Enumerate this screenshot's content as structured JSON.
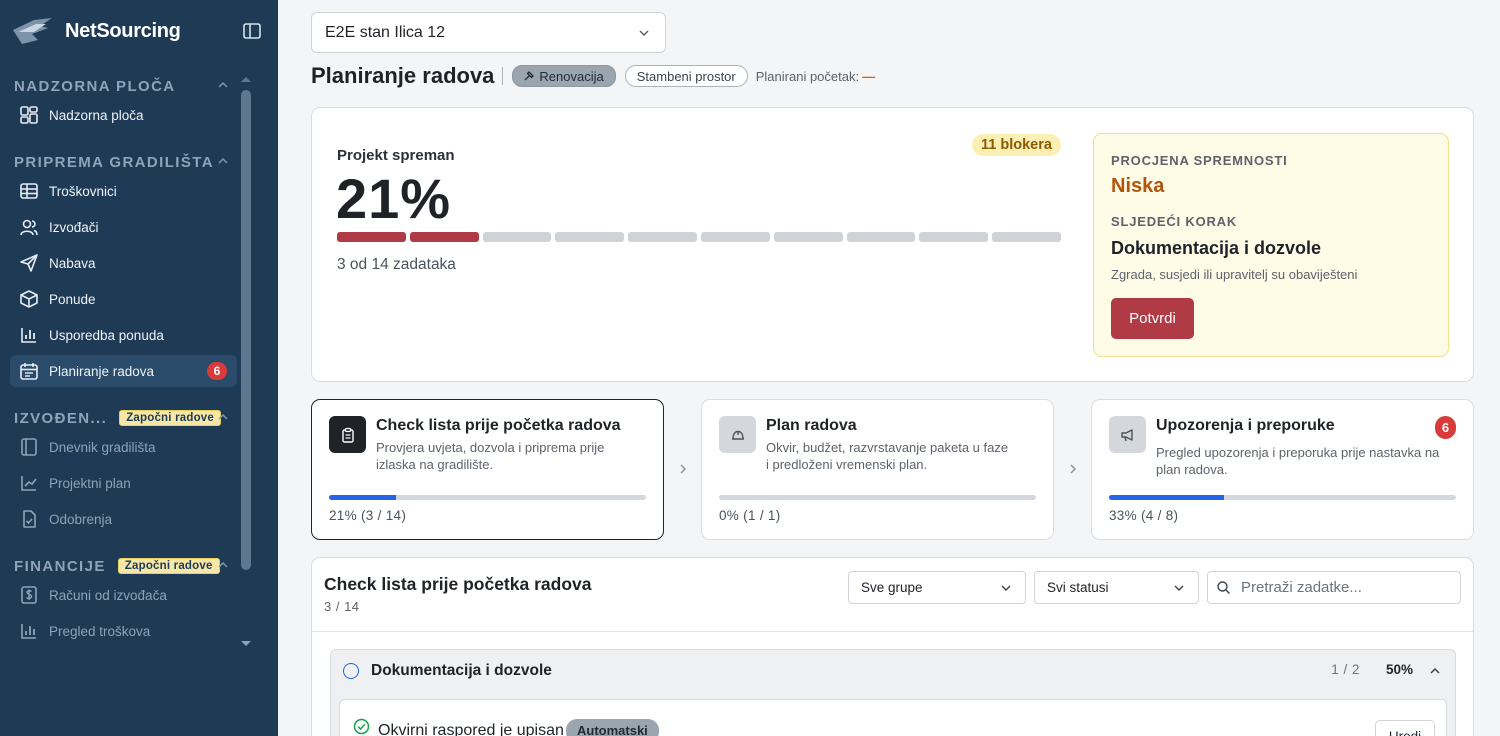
{
  "app": {
    "name": "NetSourcing"
  },
  "sidebar": {
    "sections": [
      {
        "title": "NADZORNA PLOČA"
      },
      {
        "title": "PRIPREMA GRADILIŠTA"
      },
      {
        "title": "IZVOĐEN...",
        "badge": "Započni radove"
      },
      {
        "title": "FINANCIJE",
        "badge": "Započni radove"
      }
    ],
    "items": [
      {
        "label": "Nadzorna ploča",
        "icon": "dashboard-icon"
      },
      {
        "label": "Troškovnici",
        "icon": "table-icon"
      },
      {
        "label": "Izvođači",
        "icon": "users-icon"
      },
      {
        "label": "Nabava",
        "icon": "send-icon"
      },
      {
        "label": "Ponude",
        "icon": "package-icon"
      },
      {
        "label": "Usporedba ponuda",
        "icon": "bar-chart-icon"
      },
      {
        "label": "Planiranje radova",
        "icon": "calendar-icon",
        "count": "6"
      },
      {
        "label": "Dnevnik gradilišta",
        "icon": "notebook-icon"
      },
      {
        "label": "Projektni plan",
        "icon": "line-chart-icon"
      },
      {
        "label": "Odobrenja",
        "icon": "file-check-icon"
      },
      {
        "label": "Računi od izvođača",
        "icon": "invoice-icon"
      },
      {
        "label": "Pregled troškova",
        "icon": "bar-chart-icon"
      }
    ]
  },
  "header": {
    "project": "E2E stan Ilica 12",
    "title": "Planiranje radova",
    "tag_type": "Renovacija",
    "tag_space": "Stambeni prostor",
    "planned_start_label": "Planirani početak:",
    "planned_start_value": "—"
  },
  "overview": {
    "label": "Projekt spreman",
    "percent": "21%",
    "blockers": "11 blokera",
    "tasks_text": "3 od 14 zadataka",
    "segments_total": 10,
    "segments_done": 2,
    "readiness_label": "PROCJENA SPREMNOSTI",
    "readiness_level": "Niska",
    "next_step_label": "SLJEDEĆI KORAK",
    "next_step_title": "Dokumentacija i dozvole",
    "next_step_desc": "Zgrada, susjedi ili upravitelj su obaviješteni",
    "confirm_label": "Potvrdi"
  },
  "phases": [
    {
      "title": "Check lista prije početka radova",
      "desc": "Provjera uvjeta, dozvola i priprema prije izlaska na gradilište.",
      "progress_text": "21% (3 / 14)",
      "progress": 0.21,
      "icon": "clipboard-icon"
    },
    {
      "title": "Plan radova",
      "desc": "Okvir, budžet, razvrstavanje paketa u faze i predloženi vremenski plan.",
      "progress_text": "0% (1 / 1)",
      "progress": 0,
      "icon": "helmet-icon"
    },
    {
      "title": "Upozorenja i preporuke",
      "desc": "Pregled upozorenja i preporuka prije nastavka na plan radova.",
      "progress_text": "33% (4 / 8)",
      "progress": 0.33,
      "count": "6",
      "icon": "megaphone-icon"
    }
  ],
  "checklist": {
    "title": "Check lista prije početka radova",
    "count": "3 / 14",
    "group_filter": "Sve grupe",
    "status_filter": "Svi statusi",
    "search_placeholder": "Pretraži zadatke...",
    "group": {
      "title": "Dokumentacija i dozvole",
      "fraction": "1 / 2",
      "percent": "50%",
      "task": {
        "title": "Okvirni raspored je upisan",
        "tag": "Automatski",
        "edit_label": "Uredi"
      }
    }
  },
  "colors": {
    "sidebar": "#1f3a55",
    "accent_red": "#b03a46",
    "progress_blue": "#2563eb",
    "badge_yellow": "#fbefb4"
  }
}
